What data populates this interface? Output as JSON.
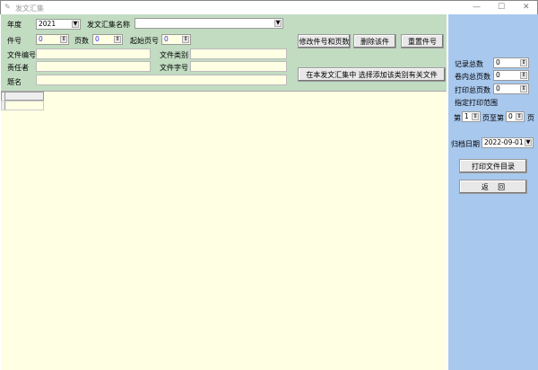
{
  "window": {
    "title": "发文汇集",
    "minimize": "—",
    "maximize": "☐",
    "close": "✕"
  },
  "form": {
    "year_label": "年度",
    "year_value": "2021",
    "collection_label": "发文汇集名称",
    "collection_value": "",
    "item_no_label": "件号",
    "item_no_value": "0",
    "pages_label": "页数",
    "pages_value": "0",
    "start_page_label": "起始页号",
    "start_page_value": "0",
    "file_no_label": "文件编号",
    "file_no_value": "",
    "file_category_label": "文件类别",
    "file_category_value": "",
    "responsible_label": "责任者",
    "responsible_value": "",
    "file_ref_label": "文件字号",
    "file_ref_value": "",
    "title_label": "题名",
    "title_value": ""
  },
  "buttons": {
    "modify": "修改件号和页数",
    "delete": "删除该件",
    "reset": "重置件号",
    "add": "在本发文汇集中  选择添加该类别有关文件",
    "print_catalog": "打印文件目录",
    "back": "返    回"
  },
  "side": {
    "record_total_label": "记录总数",
    "record_total_value": "0",
    "volume_pages_label": "卷内总页数",
    "volume_pages_value": "0",
    "print_pages_label": "打印总页数",
    "print_pages_value": "0",
    "range_label": "指定打印范围",
    "from_prefix": "第",
    "from_value": "1",
    "to_mid": "页至第",
    "to_value": "0",
    "to_suffix": "页",
    "archive_date_label": "归档日期",
    "archive_date_value": "2022-09-01"
  }
}
